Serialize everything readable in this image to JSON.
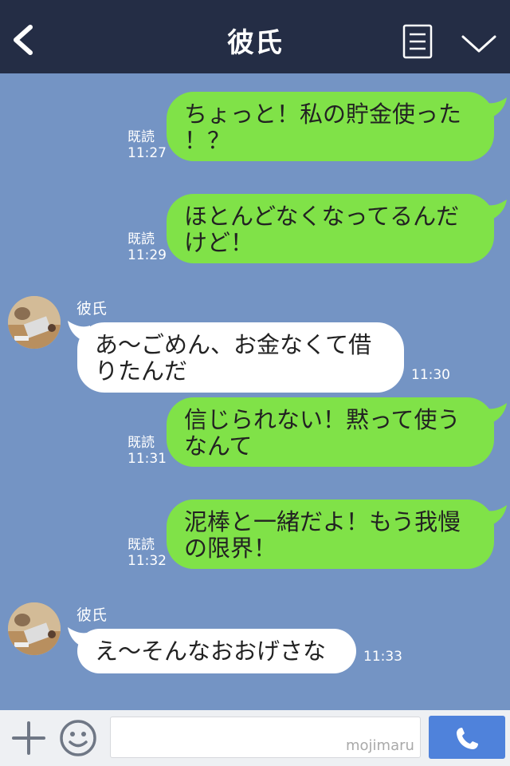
{
  "header": {
    "title": "彼氏"
  },
  "messages": [
    {
      "type": "sent",
      "read": "既読",
      "time": "11:27",
      "line1": "ちょっと！私の貯金使った",
      "line2": "！？"
    },
    {
      "type": "sent",
      "read": "既読",
      "time": "11:29",
      "line1": "ほとんどなくなってるんだ",
      "line2": "けど！"
    },
    {
      "type": "received",
      "sender": "彼氏",
      "time": "11:30",
      "line1": "あ〜ごめん、お金なくて借",
      "line2": "りたんだ"
    },
    {
      "type": "sent",
      "read": "既読",
      "time": "11:31",
      "line1": "信じられない！黙って使う",
      "line2": "なんて"
    },
    {
      "type": "sent",
      "read": "既読",
      "time": "11:32",
      "line1": "泥棒と一緒だよ！もう我慢",
      "line2": "の限界！"
    },
    {
      "type": "received",
      "sender": "彼氏",
      "time": "11:33",
      "line1": "え〜そんなおおげさな"
    }
  ],
  "footer": {
    "watermark": "mojimaru"
  },
  "colors": {
    "header": "#242d45",
    "background": "#7494c4",
    "sent_bubble": "#80e248",
    "received_bubble": "#ffffff",
    "call_button": "#4f82db"
  },
  "icons": [
    "back-icon",
    "menu-icon",
    "chevron-down-icon",
    "plus-icon",
    "smile-icon",
    "phone-icon"
  ]
}
